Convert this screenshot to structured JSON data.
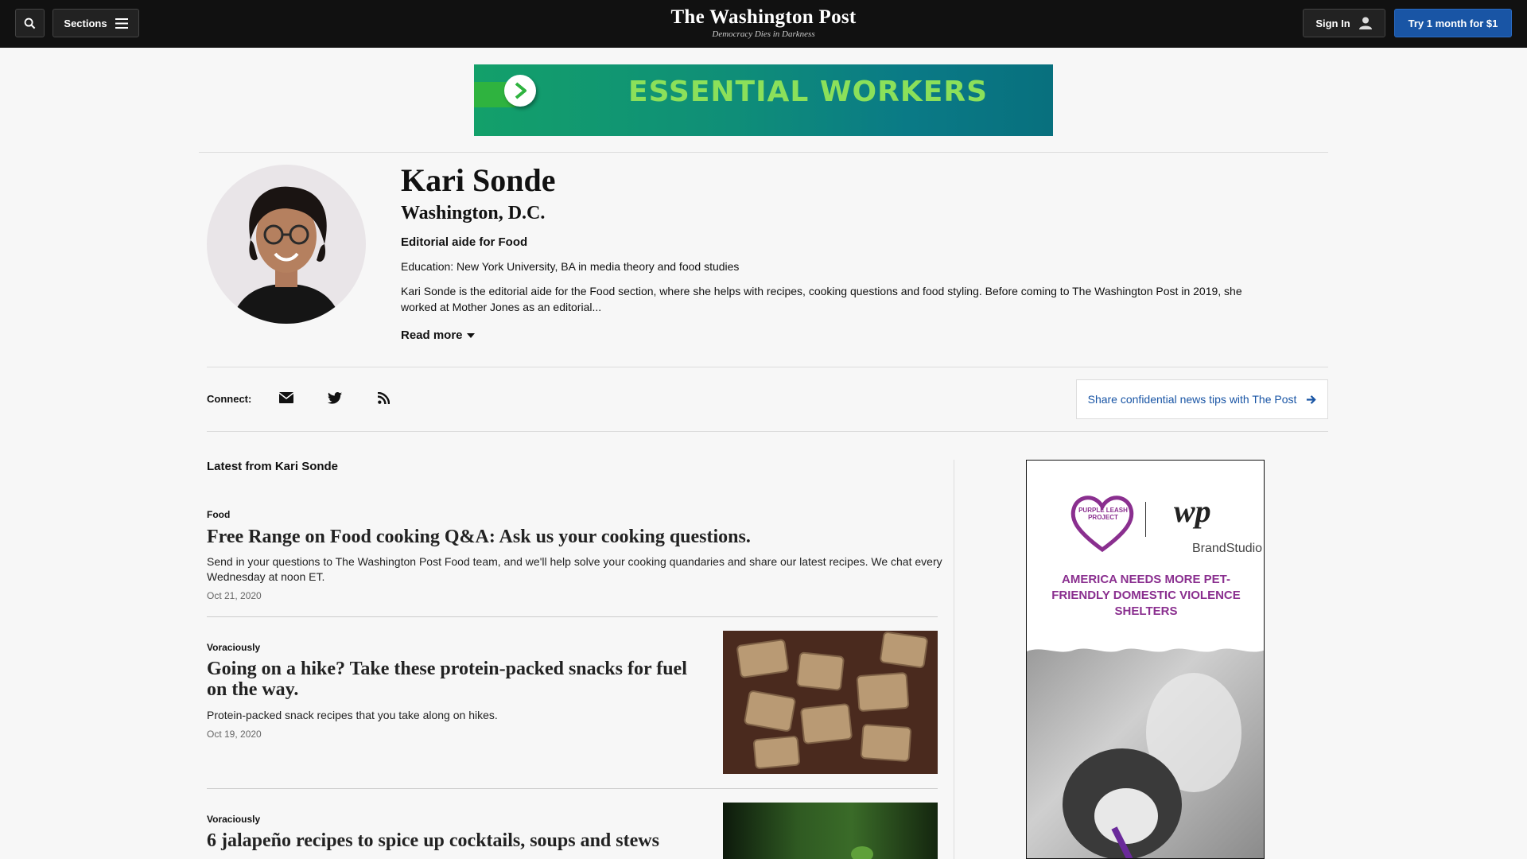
{
  "nav": {
    "sections_label": "Sections",
    "logo_title": "The Washington Post",
    "logo_tagline": "Democracy Dies in Darkness",
    "signin_label": "Sign In",
    "try_label": "Try 1 month for $1",
    "icons": [
      "search-icon",
      "hamburger-icon",
      "user-icon"
    ]
  },
  "banner_ad": {
    "text": "ESSENTIAL WORKERS",
    "colors": {
      "text": "#8be05a",
      "background": "#0f8e78"
    }
  },
  "profile": {
    "name": "Kari Sonde",
    "location": "Washington, D.C.",
    "role": "Editorial aide for Food",
    "education": "Education: New York University, BA in media theory and food studies",
    "bio": "Kari Sonde is the editorial aide for the Food section, where she helps with recipes, cooking questions and food styling. Before coming to The Washington Post in 2019, she worked at Mother Jones as an editorial...",
    "read_more": "Read more"
  },
  "connect": {
    "label": "Connect:",
    "icons": [
      "email-icon",
      "twitter-icon",
      "rss-icon"
    ],
    "tips_label": "Share confidential news tips with The Post"
  },
  "feed": {
    "heading": "Latest from Kari Sonde",
    "articles": [
      {
        "kicker": "Food",
        "headline": "Free Range on Food cooking Q&A: Ask us your cooking questions.",
        "blurb": "Send in your questions to The Washington Post Food team, and we'll help solve your cooking quandaries and share our latest recipes. We chat every Wednesday at noon ET.",
        "date": "Oct 21, 2020"
      },
      {
        "kicker": "Voraciously",
        "headline": "Going on a hike? Take these protein-packed snacks for fuel on the way.",
        "blurb": "Protein-packed snack recipes that you take along on hikes.",
        "date": "Oct 19, 2020"
      },
      {
        "kicker": "Voraciously",
        "headline": "6 jalapeño recipes to spice up cocktails, soups and stews"
      }
    ]
  },
  "side_ad": {
    "logo_text": "PURPLE LEASH PROJECT",
    "wp_mark": "wp",
    "brand": "BrandStudio",
    "headline": "AMERICA NEEDS MORE PET-FRIENDLY DOMESTIC VIOLENCE SHELTERS",
    "colors": {
      "headline": "#8a2f8f"
    }
  },
  "colors": {
    "nav_bg": "#111111",
    "accent_blue": "#1955a5",
    "page_bg": "#f7f7f7"
  }
}
